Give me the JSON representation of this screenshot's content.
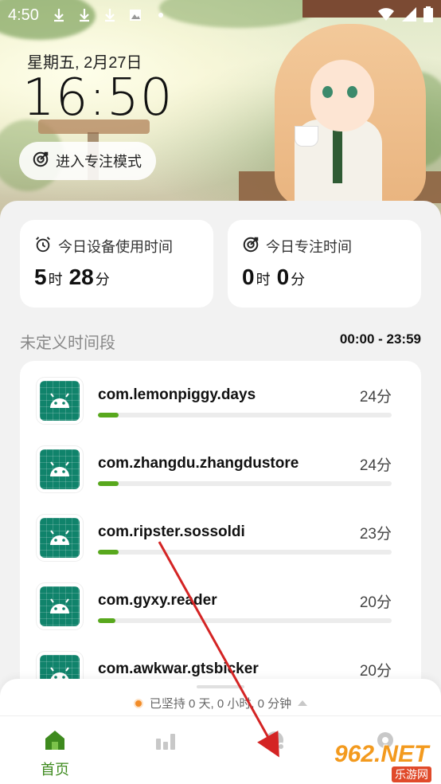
{
  "status_bar": {
    "time": "4:50",
    "icons": [
      "download-icon",
      "download-icon",
      "download-icon",
      "image-icon",
      "dot-icon",
      "wifi-icon",
      "signal-icon",
      "battery-icon"
    ]
  },
  "header": {
    "date": "星期五, 2月27日",
    "clock": "16:50",
    "focus_button_label": "进入专注模式"
  },
  "stats": {
    "device_usage": {
      "label": "今日设备使用时间",
      "hours": "5",
      "hours_unit": "时",
      "minutes": "28",
      "minutes_unit": "分"
    },
    "focus_time": {
      "label": "今日专注时间",
      "hours": "0",
      "hours_unit": "时",
      "minutes": "0",
      "minutes_unit": "分"
    }
  },
  "section": {
    "title": "未定义时间段",
    "range": "00:00 - 23:59"
  },
  "apps": [
    {
      "name": "com.lemonpiggy.days",
      "time": "24分",
      "progress": 0.07
    },
    {
      "name": "com.zhangdu.zhangdustore",
      "time": "24分",
      "progress": 0.07
    },
    {
      "name": "com.ripster.sossoldi",
      "time": "23分",
      "progress": 0.07
    },
    {
      "name": "com.gyxy.reader",
      "time": "20分",
      "progress": 0.06
    },
    {
      "name": "com.awkwar.gtsbicker",
      "time": "20分",
      "progress": 0.06
    }
  ],
  "streak": {
    "text": "已坚持 0 天, 0 小时, 0 分钟"
  },
  "tabs": [
    {
      "label": "首页",
      "icon": "home-icon",
      "active": true
    },
    {
      "label": "",
      "icon": "bar-chart-icon",
      "active": false
    },
    {
      "label": "",
      "icon": "pie-chart-icon",
      "active": false
    },
    {
      "label": "",
      "icon": "settings-icon",
      "active": false
    }
  ],
  "watermark": {
    "big": "962.NET",
    "small": "乐游网"
  },
  "colors": {
    "accent": "#58a81d",
    "tab_active": "#3e8a1e",
    "app_icon_bg": "#10836b",
    "streak_dot": "#f28c28",
    "arrow": "#d42424"
  }
}
